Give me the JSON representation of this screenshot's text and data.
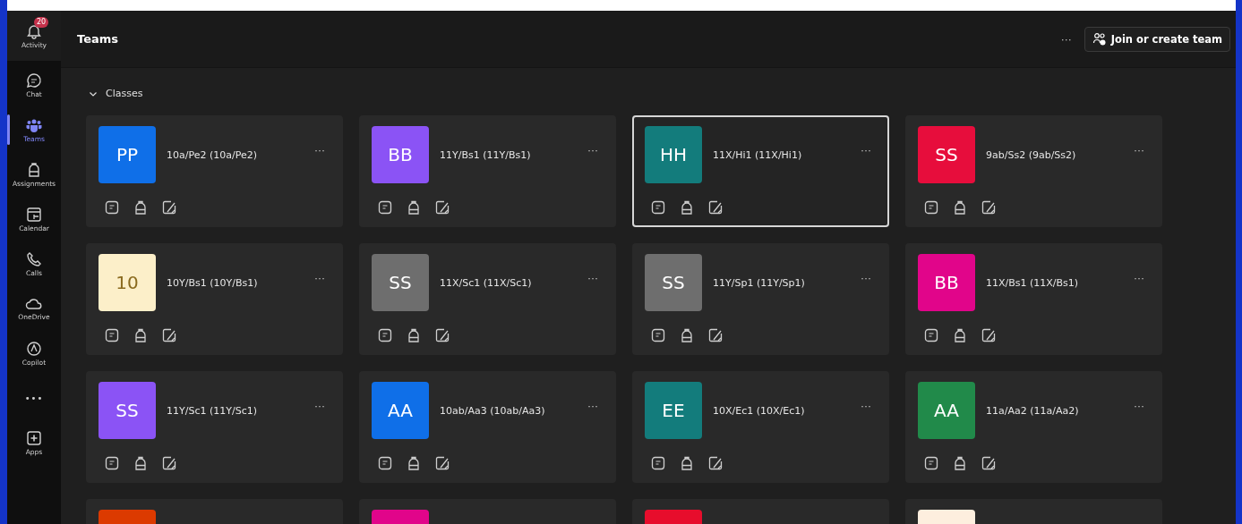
{
  "rail": [
    {
      "label": "Activity",
      "kind": "bell",
      "badge": "20",
      "selected": false
    },
    {
      "label": "Chat",
      "kind": "chat",
      "selected": false
    },
    {
      "label": "Teams",
      "kind": "teams",
      "selected": true
    },
    {
      "label": "Assignments",
      "kind": "backpack",
      "selected": false
    },
    {
      "label": "Calendar",
      "kind": "calendar",
      "selected": false
    },
    {
      "label": "Calls",
      "kind": "phone",
      "selected": false
    },
    {
      "label": "OneDrive",
      "kind": "cloud",
      "selected": false
    },
    {
      "label": "Copilot",
      "kind": "copilot",
      "selected": false
    },
    {
      "label": "•••",
      "kind": "more",
      "selected": false
    },
    {
      "label": "Apps",
      "kind": "apps",
      "selected": false
    }
  ],
  "header": {
    "title": "Teams",
    "more": "···",
    "join_button": "Join or create team"
  },
  "section": {
    "title": "Classes",
    "expanded": true
  },
  "teams": [
    {
      "initials": "PP",
      "name": "10a/Pe2 (10a/Pe2)",
      "color": "#0f6fe8",
      "selected": false
    },
    {
      "initials": "BB",
      "name": "11Y/Bs1 (11Y/Bs1)",
      "color": "#8b53f5",
      "selected": false
    },
    {
      "initials": "HH",
      "name": "11X/Hi1 (11X/Hi1)",
      "color": "#137c7c",
      "selected": true
    },
    {
      "initials": "SS",
      "name": "9ab/Ss2 (9ab/Ss2)",
      "color": "#e70d3c",
      "selected": false
    },
    {
      "initials": "10",
      "name": "10Y/Bs1 (10Y/Bs1)",
      "color": "#fcefc9",
      "selected": false
    },
    {
      "initials": "SS",
      "name": "11X/Sc1 (11X/Sc1)",
      "color": "#6e6e6e",
      "selected": false
    },
    {
      "initials": "SS",
      "name": "11Y/Sp1 (11Y/Sp1)",
      "color": "#6e6e6e",
      "selected": false
    },
    {
      "initials": "BB",
      "name": "11X/Bs1 (11X/Bs1)",
      "color": "#e1058a",
      "selected": false
    },
    {
      "initials": "SS",
      "name": "11Y/Sc1 (11Y/Sc1)",
      "color": "#8b53f5",
      "selected": false
    },
    {
      "initials": "AA",
      "name": "10ab/Aa3 (10ab/Aa3)",
      "color": "#0f6fe8",
      "selected": false
    },
    {
      "initials": "EE",
      "name": "10X/Ec1 (10X/Ec1)",
      "color": "#137c7c",
      "selected": false
    },
    {
      "initials": "AA",
      "name": "11a/Aa2 (11a/Aa2)",
      "color": "#218a4a",
      "selected": false
    },
    {
      "color": "#dc3a00",
      "selected": false
    },
    {
      "color": "#e1058a",
      "selected": false
    },
    {
      "color": "#e70d2c",
      "selected": false
    },
    {
      "color": "#fdeede",
      "selected": false
    }
  ],
  "card_more": "···"
}
